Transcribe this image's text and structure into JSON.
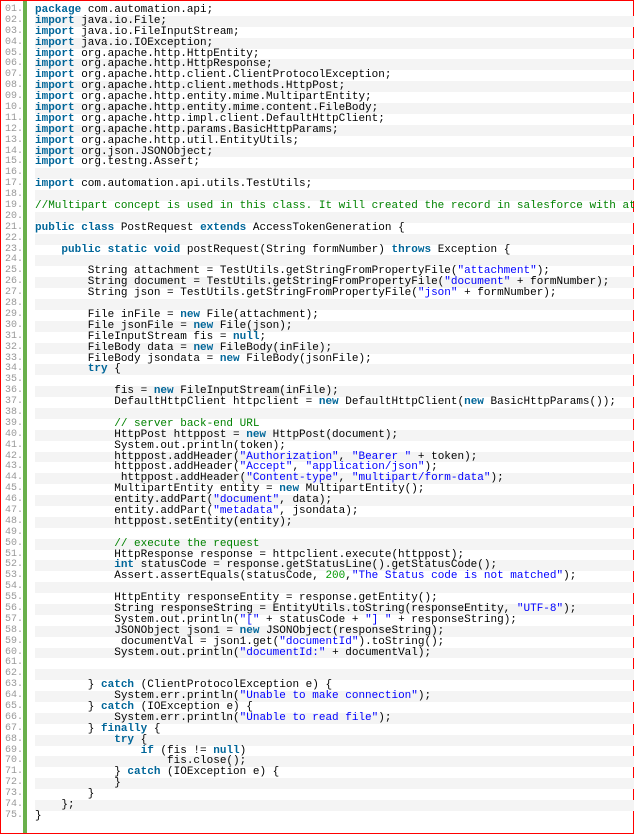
{
  "lines": [
    {
      "num": "01.",
      "tokens": [
        {
          "t": "keyword",
          "v": "package"
        },
        {
          "t": "plain",
          "v": " com.automation.api;"
        }
      ]
    },
    {
      "num": "02.",
      "tokens": [
        {
          "t": "keyword",
          "v": "import"
        },
        {
          "t": "plain",
          "v": " java.io.File;"
        }
      ]
    },
    {
      "num": "03.",
      "tokens": [
        {
          "t": "keyword",
          "v": "import"
        },
        {
          "t": "plain",
          "v": " java.io.FileInputStream;"
        }
      ]
    },
    {
      "num": "04.",
      "tokens": [
        {
          "t": "keyword",
          "v": "import"
        },
        {
          "t": "plain",
          "v": " java.io.IOException;"
        }
      ]
    },
    {
      "num": "05.",
      "tokens": [
        {
          "t": "keyword",
          "v": "import"
        },
        {
          "t": "plain",
          "v": " org.apache.http.HttpEntity;"
        }
      ]
    },
    {
      "num": "06.",
      "tokens": [
        {
          "t": "keyword",
          "v": "import"
        },
        {
          "t": "plain",
          "v": " org.apache.http.HttpResponse;"
        }
      ]
    },
    {
      "num": "07.",
      "tokens": [
        {
          "t": "keyword",
          "v": "import"
        },
        {
          "t": "plain",
          "v": " org.apache.http.client.ClientProtocolException;"
        }
      ]
    },
    {
      "num": "08.",
      "tokens": [
        {
          "t": "keyword",
          "v": "import"
        },
        {
          "t": "plain",
          "v": " org.apache.http.client.methods.HttpPost;"
        }
      ]
    },
    {
      "num": "09.",
      "tokens": [
        {
          "t": "keyword",
          "v": "import"
        },
        {
          "t": "plain",
          "v": " org.apache.http.entity.mime.MultipartEntity;"
        }
      ]
    },
    {
      "num": "10.",
      "tokens": [
        {
          "t": "keyword",
          "v": "import"
        },
        {
          "t": "plain",
          "v": " org.apache.http.entity.mime.content.FileBody;"
        }
      ]
    },
    {
      "num": "11.",
      "tokens": [
        {
          "t": "keyword",
          "v": "import"
        },
        {
          "t": "plain",
          "v": " org.apache.http.impl.client.DefaultHttpClient;"
        }
      ]
    },
    {
      "num": "12.",
      "tokens": [
        {
          "t": "keyword",
          "v": "import"
        },
        {
          "t": "plain",
          "v": " org.apache.http.params.BasicHttpParams;"
        }
      ]
    },
    {
      "num": "13.",
      "tokens": [
        {
          "t": "keyword",
          "v": "import"
        },
        {
          "t": "plain",
          "v": " org.apache.http.util.EntityUtils;"
        }
      ]
    },
    {
      "num": "14.",
      "tokens": [
        {
          "t": "keyword",
          "v": "import"
        },
        {
          "t": "plain",
          "v": " org.json.JSONObject;"
        }
      ]
    },
    {
      "num": "15.",
      "tokens": [
        {
          "t": "keyword",
          "v": "import"
        },
        {
          "t": "plain",
          "v": " org.testng.Assert;"
        }
      ]
    },
    {
      "num": "16.",
      "tokens": []
    },
    {
      "num": "17.",
      "tokens": [
        {
          "t": "keyword",
          "v": "import"
        },
        {
          "t": "plain",
          "v": " com.automation.api.utils.TestUtils;"
        }
      ]
    },
    {
      "num": "18.",
      "tokens": []
    },
    {
      "num": "19.",
      "tokens": [
        {
          "t": "comment",
          "v": "//Multipart concept is used in this class. It will created the record in salesforce with attachment"
        }
      ]
    },
    {
      "num": "20.",
      "tokens": []
    },
    {
      "num": "21.",
      "tokens": [
        {
          "t": "keyword",
          "v": "public"
        },
        {
          "t": "plain",
          "v": " "
        },
        {
          "t": "keyword",
          "v": "class"
        },
        {
          "t": "plain",
          "v": " PostRequest "
        },
        {
          "t": "keyword",
          "v": "extends"
        },
        {
          "t": "plain",
          "v": " AccessTokenGeneration {"
        }
      ]
    },
    {
      "num": "22.",
      "tokens": []
    },
    {
      "num": "23.",
      "tokens": [
        {
          "t": "plain",
          "v": "    "
        },
        {
          "t": "keyword",
          "v": "public"
        },
        {
          "t": "plain",
          "v": " "
        },
        {
          "t": "keyword",
          "v": "static"
        },
        {
          "t": "plain",
          "v": " "
        },
        {
          "t": "keyword",
          "v": "void"
        },
        {
          "t": "plain",
          "v": " postRequest(String formNumber) "
        },
        {
          "t": "keyword",
          "v": "throws"
        },
        {
          "t": "plain",
          "v": " Exception {"
        }
      ]
    },
    {
      "num": "24.",
      "tokens": []
    },
    {
      "num": "25.",
      "tokens": [
        {
          "t": "plain",
          "v": "        String attachment = TestUtils.getStringFromPropertyFile("
        },
        {
          "t": "string",
          "v": "\"attachment\""
        },
        {
          "t": "plain",
          "v": ");"
        }
      ]
    },
    {
      "num": "26.",
      "tokens": [
        {
          "t": "plain",
          "v": "        String document = TestUtils.getStringFromPropertyFile("
        },
        {
          "t": "string",
          "v": "\"document\""
        },
        {
          "t": "plain",
          "v": " + formNumber);"
        }
      ]
    },
    {
      "num": "27.",
      "tokens": [
        {
          "t": "plain",
          "v": "        String json = TestUtils.getStringFromPropertyFile("
        },
        {
          "t": "string",
          "v": "\"json\""
        },
        {
          "t": "plain",
          "v": " + formNumber);"
        }
      ]
    },
    {
      "num": "28.",
      "tokens": []
    },
    {
      "num": "29.",
      "tokens": [
        {
          "t": "plain",
          "v": "        File inFile = "
        },
        {
          "t": "keyword",
          "v": "new"
        },
        {
          "t": "plain",
          "v": " File(attachment);"
        }
      ]
    },
    {
      "num": "30.",
      "tokens": [
        {
          "t": "plain",
          "v": "        File jsonFile = "
        },
        {
          "t": "keyword",
          "v": "new"
        },
        {
          "t": "plain",
          "v": " File(json);"
        }
      ]
    },
    {
      "num": "31.",
      "tokens": [
        {
          "t": "plain",
          "v": "        FileInputStream fis = "
        },
        {
          "t": "keyword",
          "v": "null"
        },
        {
          "t": "plain",
          "v": ";"
        }
      ]
    },
    {
      "num": "32.",
      "tokens": [
        {
          "t": "plain",
          "v": "        FileBody data = "
        },
        {
          "t": "keyword",
          "v": "new"
        },
        {
          "t": "plain",
          "v": " FileBody(inFile);"
        }
      ]
    },
    {
      "num": "33.",
      "tokens": [
        {
          "t": "plain",
          "v": "        FileBody jsondata = "
        },
        {
          "t": "keyword",
          "v": "new"
        },
        {
          "t": "plain",
          "v": " FileBody(jsonFile);"
        }
      ]
    },
    {
      "num": "34.",
      "tokens": [
        {
          "t": "plain",
          "v": "        "
        },
        {
          "t": "keyword",
          "v": "try"
        },
        {
          "t": "plain",
          "v": " {"
        }
      ]
    },
    {
      "num": "35.",
      "tokens": []
    },
    {
      "num": "36.",
      "tokens": [
        {
          "t": "plain",
          "v": "            fis = "
        },
        {
          "t": "keyword",
          "v": "new"
        },
        {
          "t": "plain",
          "v": " FileInputStream(inFile);"
        }
      ]
    },
    {
      "num": "37.",
      "tokens": [
        {
          "t": "plain",
          "v": "            DefaultHttpClient httpclient = "
        },
        {
          "t": "keyword",
          "v": "new"
        },
        {
          "t": "plain",
          "v": " DefaultHttpClient("
        },
        {
          "t": "keyword",
          "v": "new"
        },
        {
          "t": "plain",
          "v": " BasicHttpParams());"
        }
      ]
    },
    {
      "num": "38.",
      "tokens": []
    },
    {
      "num": "39.",
      "tokens": [
        {
          "t": "plain",
          "v": "            "
        },
        {
          "t": "comment",
          "v": "// server back-end URL"
        }
      ]
    },
    {
      "num": "40.",
      "tokens": [
        {
          "t": "plain",
          "v": "            HttpPost httppost = "
        },
        {
          "t": "keyword",
          "v": "new"
        },
        {
          "t": "plain",
          "v": " HttpPost(document);"
        }
      ]
    },
    {
      "num": "41.",
      "tokens": [
        {
          "t": "plain",
          "v": "            System.out.println(token);"
        }
      ]
    },
    {
      "num": "42.",
      "tokens": [
        {
          "t": "plain",
          "v": "            httppost.addHeader("
        },
        {
          "t": "string",
          "v": "\"Authorization\""
        },
        {
          "t": "plain",
          "v": ", "
        },
        {
          "t": "string",
          "v": "\"Bearer \""
        },
        {
          "t": "plain",
          "v": " + token);"
        }
      ]
    },
    {
      "num": "43.",
      "tokens": [
        {
          "t": "plain",
          "v": "            httppost.addHeader("
        },
        {
          "t": "string",
          "v": "\"Accept\""
        },
        {
          "t": "plain",
          "v": ", "
        },
        {
          "t": "string",
          "v": "\"application/json\""
        },
        {
          "t": "plain",
          "v": ");"
        }
      ]
    },
    {
      "num": "44.",
      "tokens": [
        {
          "t": "plain",
          "v": "             httppost.addHeader("
        },
        {
          "t": "string",
          "v": "\"Content-type\""
        },
        {
          "t": "plain",
          "v": ", "
        },
        {
          "t": "string",
          "v": "\"multipart/form-data\""
        },
        {
          "t": "plain",
          "v": ");"
        }
      ]
    },
    {
      "num": "45.",
      "tokens": [
        {
          "t": "plain",
          "v": "            MultipartEntity entity = "
        },
        {
          "t": "keyword",
          "v": "new"
        },
        {
          "t": "plain",
          "v": " MultipartEntity();"
        }
      ]
    },
    {
      "num": "46.",
      "tokens": [
        {
          "t": "plain",
          "v": "            entity.addPart("
        },
        {
          "t": "string",
          "v": "\"document\""
        },
        {
          "t": "plain",
          "v": ", data);"
        }
      ]
    },
    {
      "num": "47.",
      "tokens": [
        {
          "t": "plain",
          "v": "            entity.addPart("
        },
        {
          "t": "string",
          "v": "\"metadata\""
        },
        {
          "t": "plain",
          "v": ", jsondata);"
        }
      ]
    },
    {
      "num": "48.",
      "tokens": [
        {
          "t": "plain",
          "v": "            httppost.setEntity(entity);"
        }
      ]
    },
    {
      "num": "49.",
      "tokens": []
    },
    {
      "num": "50.",
      "tokens": [
        {
          "t": "plain",
          "v": "            "
        },
        {
          "t": "comment",
          "v": "// execute the request"
        }
      ]
    },
    {
      "num": "51.",
      "tokens": [
        {
          "t": "plain",
          "v": "            HttpResponse response = httpclient.execute(httppost);"
        }
      ]
    },
    {
      "num": "52.",
      "tokens": [
        {
          "t": "plain",
          "v": "            "
        },
        {
          "t": "keyword",
          "v": "int"
        },
        {
          "t": "plain",
          "v": " statusCode = response.getStatusLine().getStatusCode();"
        }
      ]
    },
    {
      "num": "53.",
      "tokens": [
        {
          "t": "plain",
          "v": "            Assert.assertEquals(statusCode, "
        },
        {
          "t": "number",
          "v": "200"
        },
        {
          "t": "plain",
          "v": ","
        },
        {
          "t": "string",
          "v": "\"The Status code is not matched\""
        },
        {
          "t": "plain",
          "v": ");"
        }
      ]
    },
    {
      "num": "54.",
      "tokens": []
    },
    {
      "num": "55.",
      "tokens": [
        {
          "t": "plain",
          "v": "            HttpEntity responseEntity = response.getEntity();"
        }
      ]
    },
    {
      "num": "56.",
      "tokens": [
        {
          "t": "plain",
          "v": "            String responseString = EntityUtils.toString(responseEntity, "
        },
        {
          "t": "string",
          "v": "\"UTF-8\""
        },
        {
          "t": "plain",
          "v": ");"
        }
      ]
    },
    {
      "num": "57.",
      "tokens": [
        {
          "t": "plain",
          "v": "            System.out.println("
        },
        {
          "t": "string",
          "v": "\"[\""
        },
        {
          "t": "plain",
          "v": " + statusCode + "
        },
        {
          "t": "string",
          "v": "\"] \""
        },
        {
          "t": "plain",
          "v": " + responseString);"
        }
      ]
    },
    {
      "num": "58.",
      "tokens": [
        {
          "t": "plain",
          "v": "            JSONObject json1 = "
        },
        {
          "t": "keyword",
          "v": "new"
        },
        {
          "t": "plain",
          "v": " JSONObject(responseString);"
        }
      ]
    },
    {
      "num": "59.",
      "tokens": [
        {
          "t": "plain",
          "v": "             documentVal = json1.get("
        },
        {
          "t": "string",
          "v": "\"documentId\""
        },
        {
          "t": "plain",
          "v": ").toString();"
        }
      ]
    },
    {
      "num": "60.",
      "tokens": [
        {
          "t": "plain",
          "v": "            System.out.println("
        },
        {
          "t": "string",
          "v": "\"documentId:\""
        },
        {
          "t": "plain",
          "v": " + documentVal);"
        }
      ]
    },
    {
      "num": "61.",
      "tokens": []
    },
    {
      "num": "62.",
      "tokens": []
    },
    {
      "num": "63.",
      "tokens": [
        {
          "t": "plain",
          "v": "        } "
        },
        {
          "t": "keyword",
          "v": "catch"
        },
        {
          "t": "plain",
          "v": " (ClientProtocolException e) {"
        }
      ]
    },
    {
      "num": "64.",
      "tokens": [
        {
          "t": "plain",
          "v": "            System.err.println("
        },
        {
          "t": "string",
          "v": "\"Unable to make connection\""
        },
        {
          "t": "plain",
          "v": ");"
        }
      ]
    },
    {
      "num": "65.",
      "tokens": [
        {
          "t": "plain",
          "v": "        } "
        },
        {
          "t": "keyword",
          "v": "catch"
        },
        {
          "t": "plain",
          "v": " (IOException e) {"
        }
      ]
    },
    {
      "num": "66.",
      "tokens": [
        {
          "t": "plain",
          "v": "            System.err.println("
        },
        {
          "t": "string",
          "v": "\"Unable to read file\""
        },
        {
          "t": "plain",
          "v": ");"
        }
      ]
    },
    {
      "num": "67.",
      "tokens": [
        {
          "t": "plain",
          "v": "        } "
        },
        {
          "t": "keyword",
          "v": "finally"
        },
        {
          "t": "plain",
          "v": " {"
        }
      ]
    },
    {
      "num": "68.",
      "tokens": [
        {
          "t": "plain",
          "v": "            "
        },
        {
          "t": "keyword",
          "v": "try"
        },
        {
          "t": "plain",
          "v": " {"
        }
      ]
    },
    {
      "num": "69.",
      "tokens": [
        {
          "t": "plain",
          "v": "                "
        },
        {
          "t": "keyword",
          "v": "if"
        },
        {
          "t": "plain",
          "v": " (fis != "
        },
        {
          "t": "keyword",
          "v": "null"
        },
        {
          "t": "plain",
          "v": ")"
        }
      ]
    },
    {
      "num": "70.",
      "tokens": [
        {
          "t": "plain",
          "v": "                    fis.close();"
        }
      ]
    },
    {
      "num": "71.",
      "tokens": [
        {
          "t": "plain",
          "v": "            } "
        },
        {
          "t": "keyword",
          "v": "catch"
        },
        {
          "t": "plain",
          "v": " (IOException e) {"
        }
      ]
    },
    {
      "num": "72.",
      "tokens": [
        {
          "t": "plain",
          "v": "            }"
        }
      ]
    },
    {
      "num": "73.",
      "tokens": [
        {
          "t": "plain",
          "v": "        }"
        }
      ]
    },
    {
      "num": "74.",
      "tokens": [
        {
          "t": "plain",
          "v": "    };"
        }
      ]
    },
    {
      "num": "75.",
      "tokens": [
        {
          "t": "plain",
          "v": "}"
        }
      ]
    }
  ]
}
